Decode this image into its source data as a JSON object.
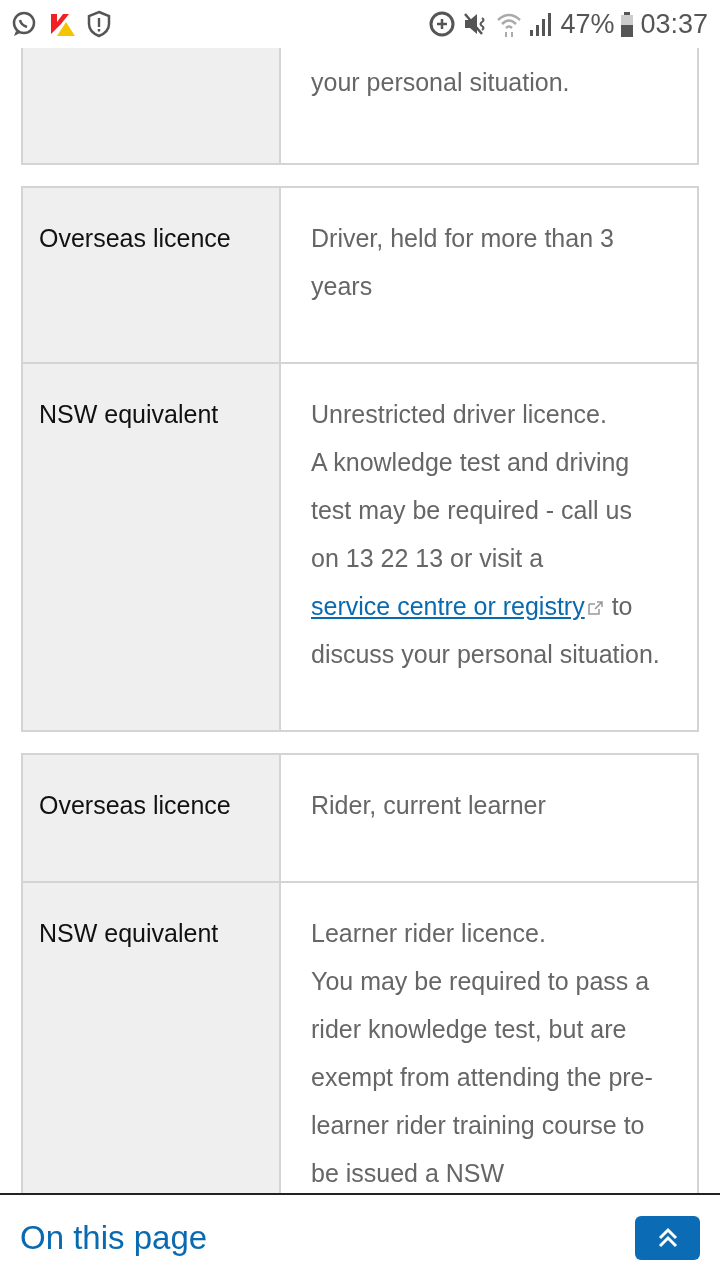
{
  "status_bar": {
    "battery": "47%",
    "time": "03:37"
  },
  "tables": [
    {
      "rows": [
        {
          "value": [
            [
              {
                "text": "your personal situation."
              }
            ]
          ]
        }
      ]
    },
    {
      "rows": [
        {
          "label": "Overseas licence",
          "value": [
            [
              {
                "text": "Driver, held for more than 3 years"
              }
            ]
          ]
        },
        {
          "label": "NSW equivalent",
          "value": [
            [
              {
                "text": "Unrestricted driver licence."
              }
            ],
            [
              {
                "text": "A knowledge test and driving test may be required - call us on 13 22 13 or visit a "
              },
              {
                "text": "service centre or registry",
                "kind": "link"
              },
              {
                "text": " to discuss your personal situation."
              }
            ]
          ]
        }
      ]
    },
    {
      "rows": [
        {
          "label": "Overseas licence",
          "value": [
            [
              {
                "text": "Rider, current learner"
              }
            ]
          ]
        },
        {
          "label": "NSW equivalent",
          "value": [
            [
              {
                "text": "Learner rider licence."
              }
            ],
            [
              {
                "text": "You may be required to pass a rider knowledge test, but are exempt from attending the pre-learner rider training course to be issued a NSW"
              }
            ]
          ]
        }
      ]
    }
  ],
  "footer": {
    "title": "On this page"
  }
}
